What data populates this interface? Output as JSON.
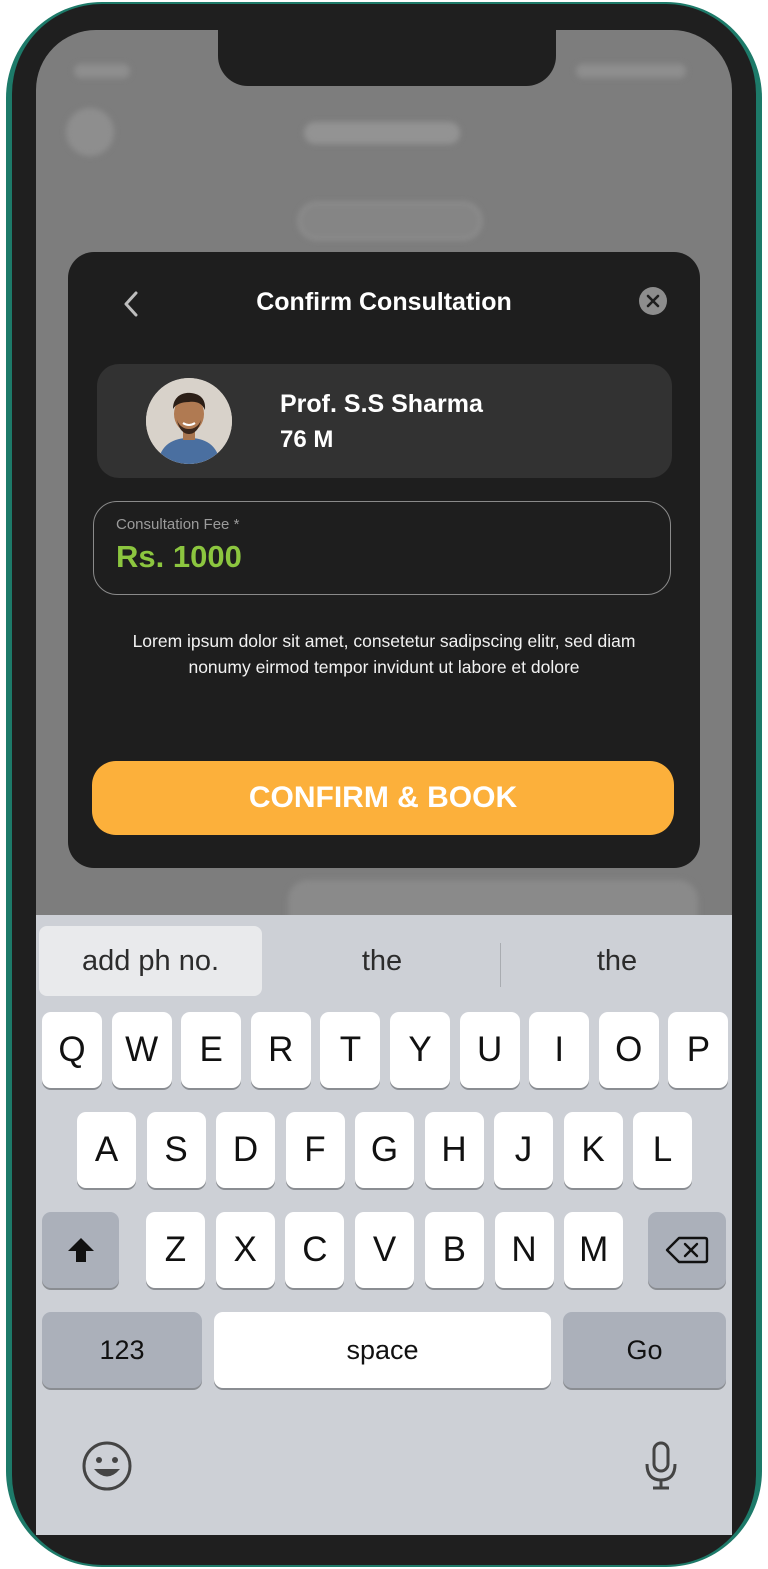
{
  "modal": {
    "title": "Confirm Consultation",
    "doctor": {
      "name": "Prof. S.S Sharma",
      "meta": "76 M"
    },
    "fee": {
      "label": "Consultation Fee *",
      "value": "Rs. 1000"
    },
    "description": "Lorem ipsum dolor sit amet, consetetur sadipscing elitr, sed diam nonumy eirmod tempor invidunt ut labore et dolore",
    "confirm_label": "CONFIRM & BOOK"
  },
  "keyboard": {
    "suggestions": [
      "add ph no.",
      "the",
      "the"
    ],
    "row1": [
      "Q",
      "W",
      "E",
      "R",
      "T",
      "Y",
      "U",
      "I",
      "O",
      "P"
    ],
    "row2": [
      "A",
      "S",
      "D",
      "F",
      "G",
      "H",
      "J",
      "K",
      "L"
    ],
    "row3": [
      "Z",
      "X",
      "C",
      "V",
      "B",
      "N",
      "M"
    ],
    "numbers_label": "123",
    "space_label": "space",
    "go_label": "Go",
    "icons": [
      "shift-icon",
      "backspace-icon",
      "emoji-icon",
      "microphone-icon"
    ]
  },
  "colors": {
    "accent": "#fcb03b",
    "fee": "#8cc63f",
    "frame": "#1d7a69",
    "modal": "#1e1e1e"
  }
}
